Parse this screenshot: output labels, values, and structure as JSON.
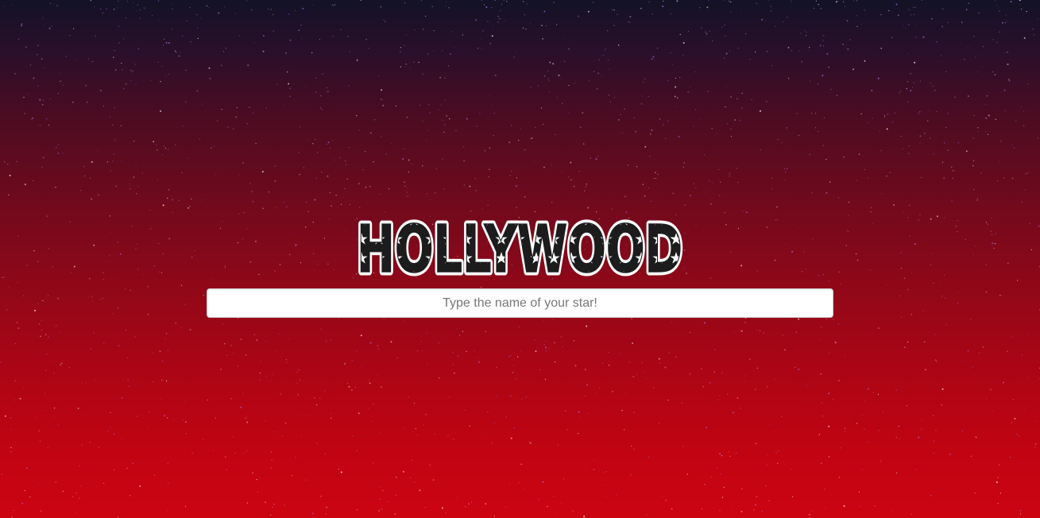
{
  "logo": {
    "text": "HOLLYWOOD"
  },
  "search": {
    "placeholder": "Type the name of your star!",
    "value": ""
  },
  "colors": {
    "background_top": "#131226",
    "background_bottom": "#cc0412",
    "logo_fill": "#1c1c1c",
    "logo_outline": "#ffffff",
    "star_color": "#ffffff"
  }
}
